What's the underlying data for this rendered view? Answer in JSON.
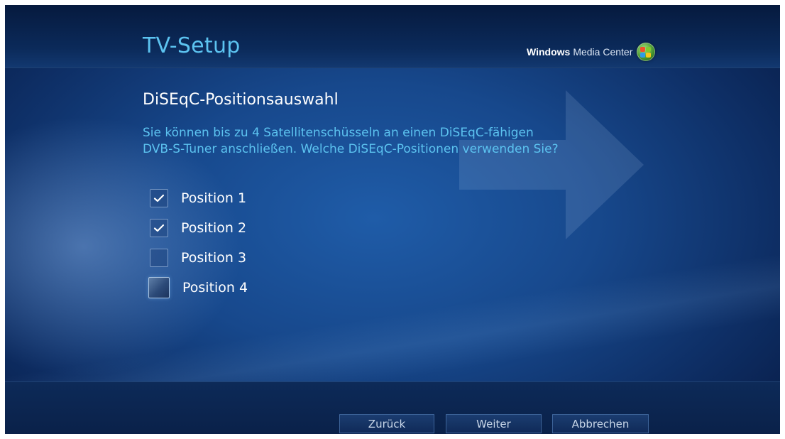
{
  "header": {
    "title": "TV-Setup",
    "brand_bold": "Windows",
    "brand_light": "Media Center",
    "brand_icon": "windows-orb-icon"
  },
  "main": {
    "heading": "DiSEqC-Positionsauswahl",
    "description_line1": "Sie können bis zu 4 Satellitenschüsseln an einen DiSEqC-fähigen",
    "description_line2": "DVB-S-Tuner anschließen. Welche DiSEqC-Positionen verwenden Sie?",
    "options": [
      {
        "label": "Position 1",
        "checked": true,
        "focused": false
      },
      {
        "label": "Position 2",
        "checked": true,
        "focused": false
      },
      {
        "label": "Position 3",
        "checked": false,
        "focused": false
      },
      {
        "label": "Position 4",
        "checked": false,
        "focused": true
      }
    ]
  },
  "footer": {
    "back_label": "Zurück",
    "next_label": "Weiter",
    "cancel_label": "Abbrechen"
  },
  "colors": {
    "accent_text": "#5cc3f0",
    "background": "#17488c",
    "header": "#0b2a5a"
  }
}
